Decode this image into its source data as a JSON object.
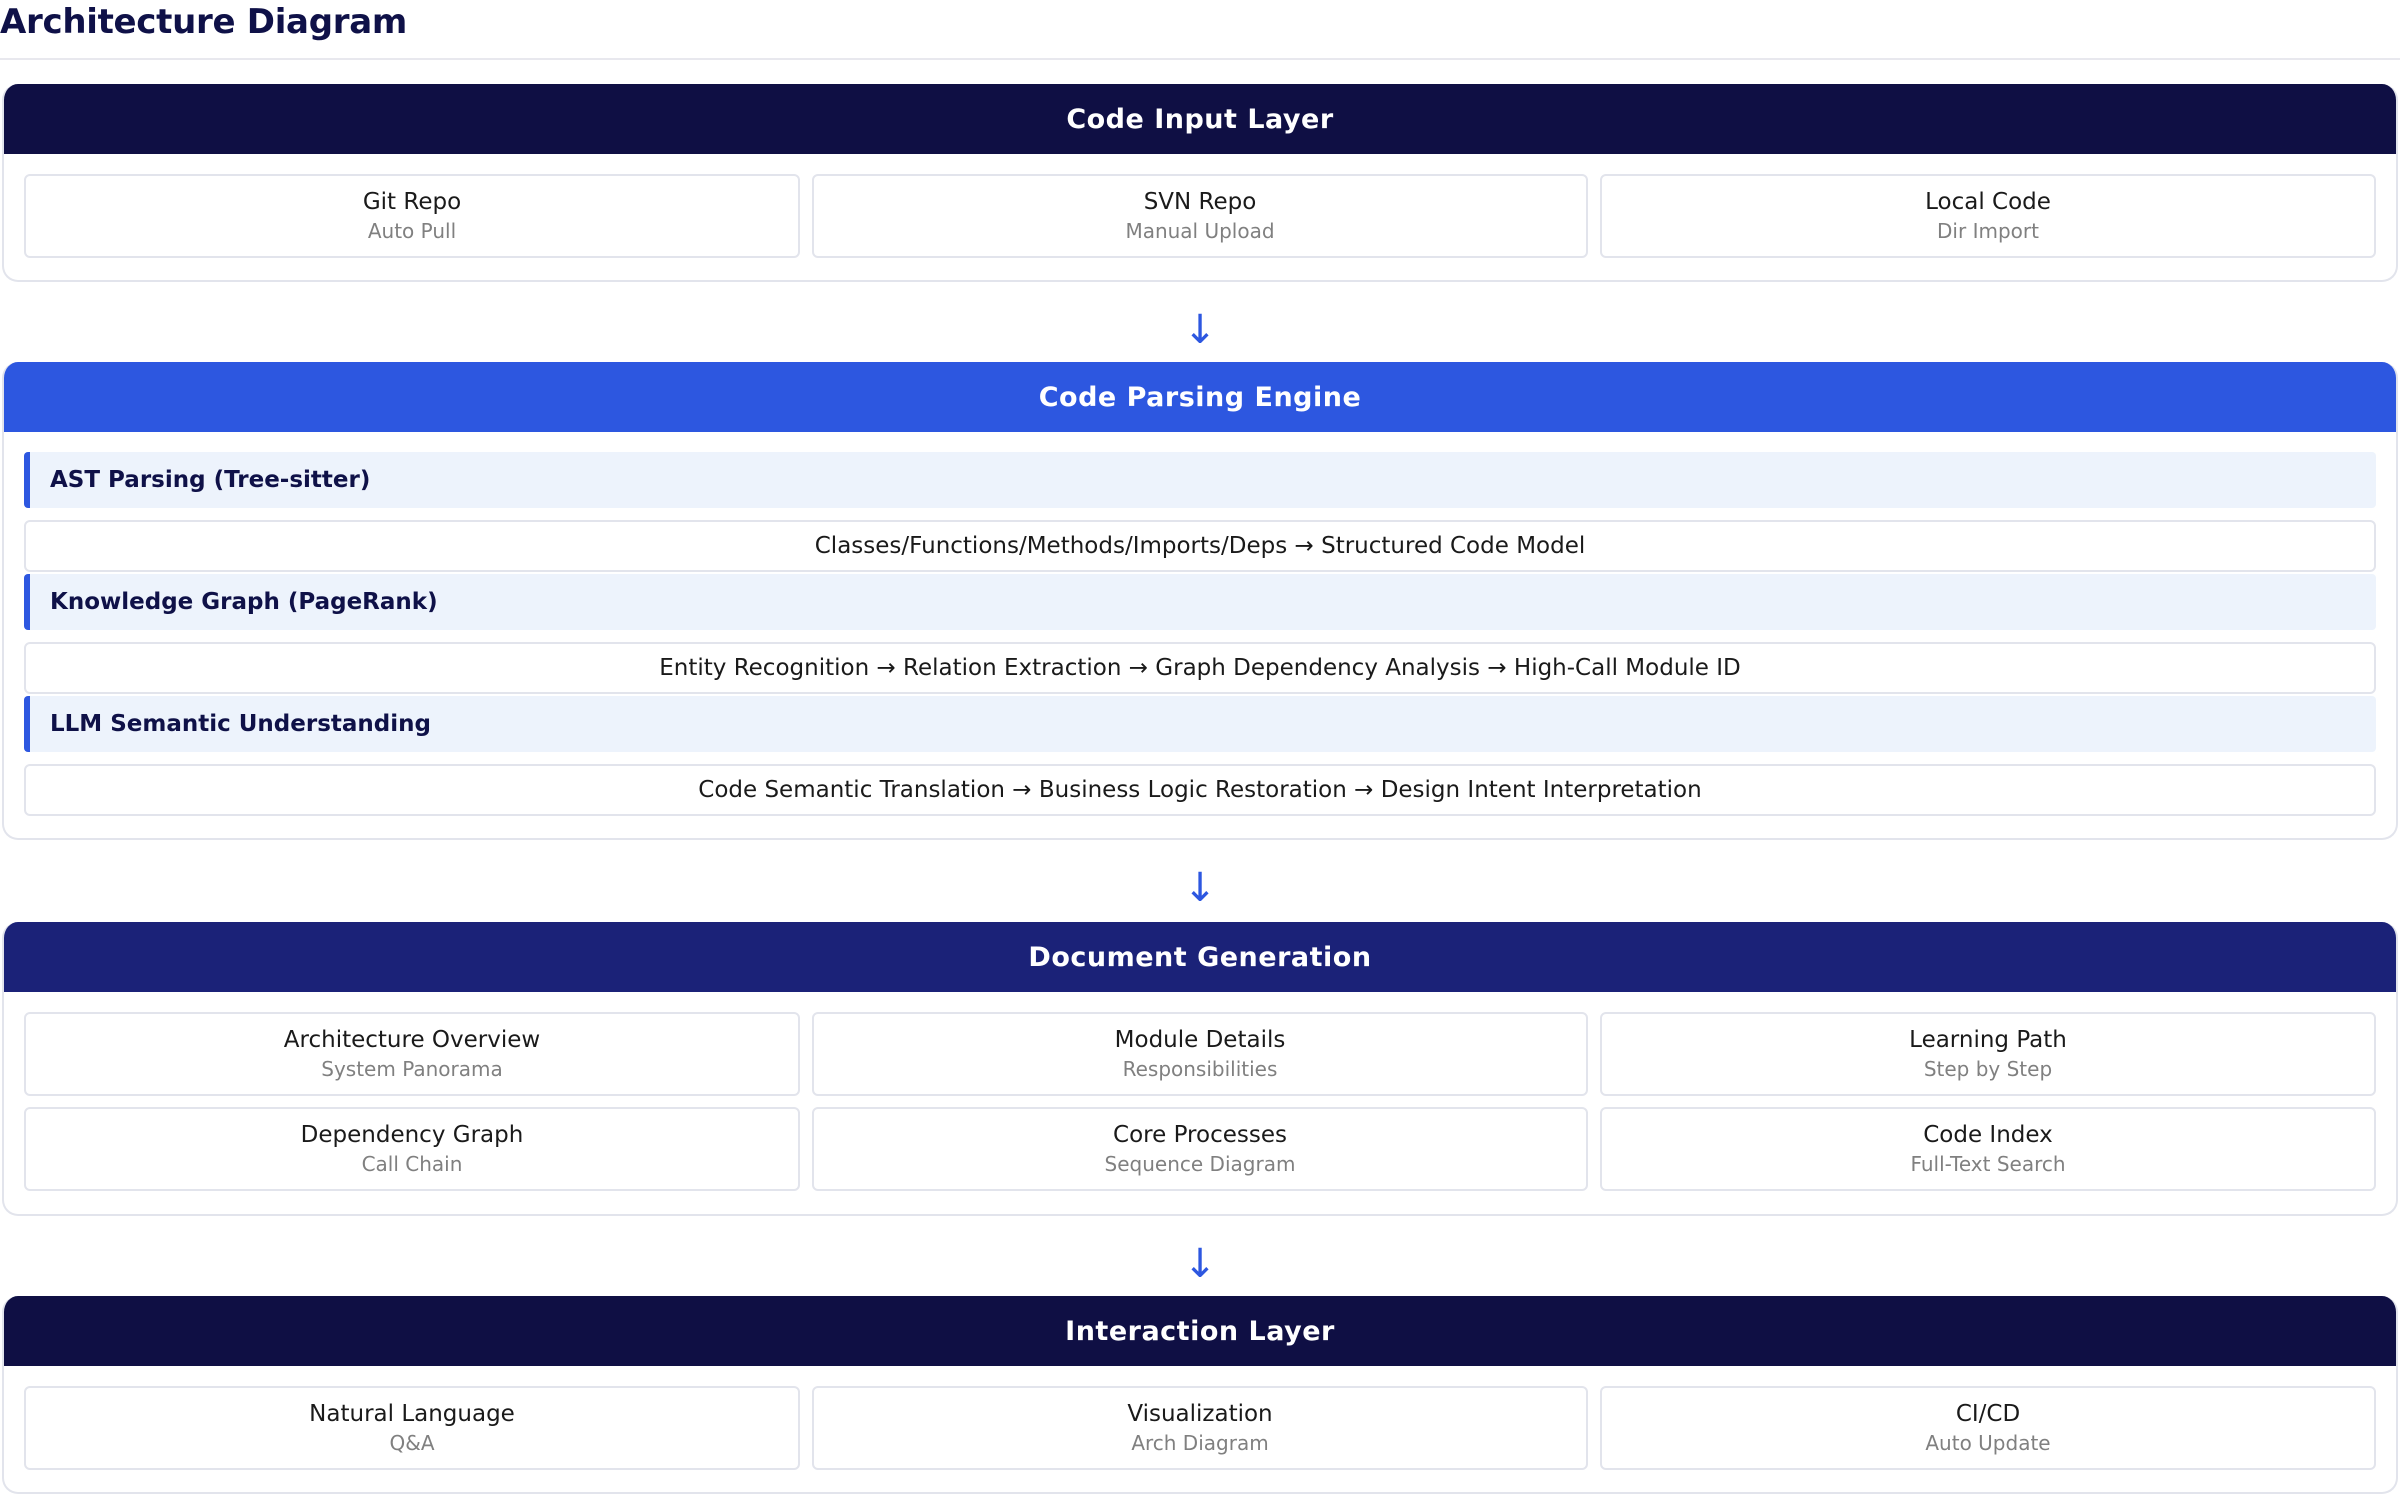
{
  "page": {
    "title": "Architecture Diagram"
  },
  "arrow_glyph": "↓",
  "input_layer": {
    "title": "Code Input Layer",
    "cards": [
      {
        "title": "Git Repo",
        "sub": "Auto Pull"
      },
      {
        "title": "SVN Repo",
        "sub": "Manual Upload"
      },
      {
        "title": "Local Code",
        "sub": "Dir Import"
      }
    ]
  },
  "parsing_engine": {
    "title": "Code Parsing Engine",
    "blocks": [
      {
        "heading": "AST Parsing (Tree-sitter)",
        "flow": "Classes/Functions/Methods/Imports/Deps → Structured Code Model"
      },
      {
        "heading": "Knowledge Graph (PageRank)",
        "flow": "Entity Recognition → Relation Extraction → Graph Dependency Analysis → High-Call Module ID"
      },
      {
        "heading": "LLM Semantic Understanding",
        "flow": "Code Semantic Translation → Business Logic Restoration → Design Intent Interpretation"
      }
    ]
  },
  "doc_generation": {
    "title": "Document Generation",
    "cards": [
      {
        "title": "Architecture Overview",
        "sub": "System Panorama"
      },
      {
        "title": "Module Details",
        "sub": "Responsibilities"
      },
      {
        "title": "Learning Path",
        "sub": "Step by Step"
      },
      {
        "title": "Dependency Graph",
        "sub": "Call Chain"
      },
      {
        "title": "Core Processes",
        "sub": "Sequence Diagram"
      },
      {
        "title": "Code Index",
        "sub": "Full-Text Search"
      }
    ]
  },
  "interaction_layer": {
    "title": "Interaction Layer",
    "cards": [
      {
        "title": "Natural Language",
        "sub": "Q&A"
      },
      {
        "title": "Visualization",
        "sub": "Arch Diagram"
      },
      {
        "title": "CI/CD",
        "sub": "Auto Update"
      }
    ]
  },
  "colors": {
    "header_dark": "#0f0f44",
    "header_blue": "#2d57e0",
    "header_navy": "#1b2278",
    "subhead_bg": "#edf3fc",
    "accent": "#2d57e0"
  }
}
